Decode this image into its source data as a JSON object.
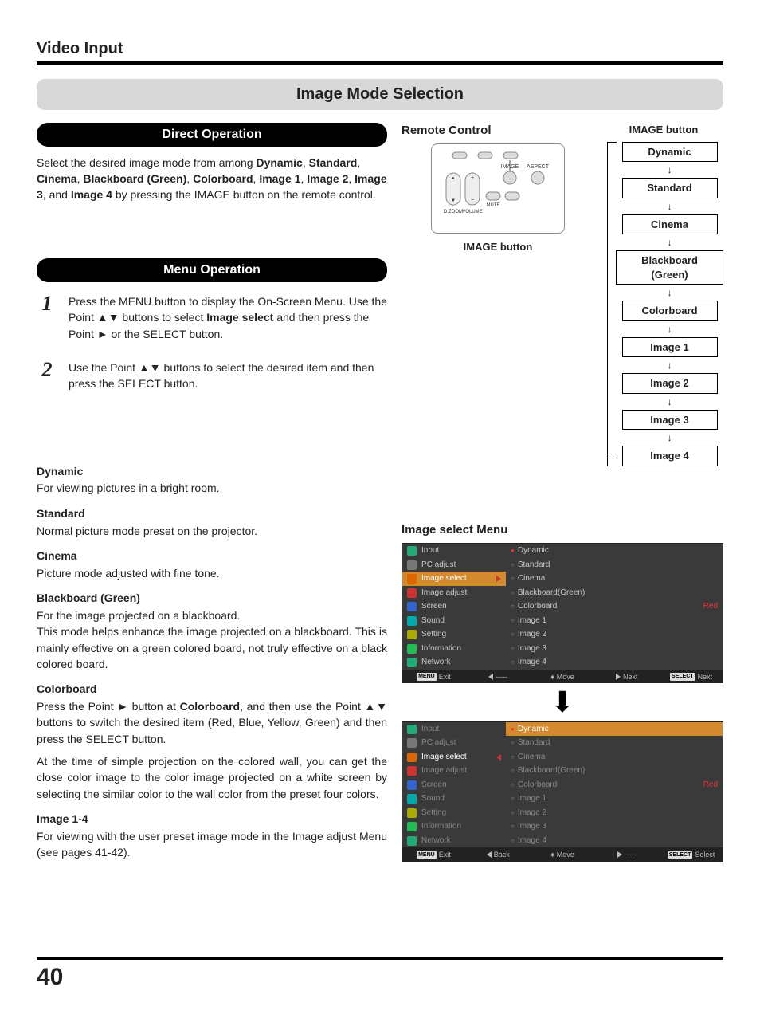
{
  "header": "Video Input",
  "title": "Image Mode Selection",
  "direct_op": {
    "heading": "Direct Operation",
    "text_pre": "Select the desired image mode from among ",
    "modes": "Dynamic, Standard, Cinema, Blackboard (Green), Colorboard, Image 1, Image 2, Image 3, and Image 4",
    "text_post": " by pressing the IMAGE button on the remote control."
  },
  "menu_op": {
    "heading": "Menu Operation",
    "steps": [
      {
        "num": "1",
        "text_pre": "Press the MENU button to display the On-Screen Menu. Use the Point ▲▼ buttons to select ",
        "bold": "Image select",
        "text_post": " and then press the Point ► or the SELECT button."
      },
      {
        "num": "2",
        "text_pre": "Use the Point ▲▼ buttons to select the desired item and then press the SELECT button.",
        "bold": "",
        "text_post": ""
      }
    ]
  },
  "modes_desc": [
    {
      "title": "Dynamic",
      "desc": "For viewing pictures in a bright room."
    },
    {
      "title": "Standard",
      "desc": "Normal picture mode preset on the projector."
    },
    {
      "title": "Cinema",
      "desc": "Picture mode adjusted with fine tone."
    },
    {
      "title": "Blackboard (Green)",
      "desc": "For the image projected on a blackboard.\nThis mode helps enhance the image projected on a blackboard. This is mainly effective on a green colored board, not truly effective on a black colored board."
    },
    {
      "title": "Colorboard",
      "desc_pre": "Press the Point ► button at ",
      "bold": "Colorboard",
      "desc_mid": ", and then use the Point ▲▼ buttons to switch the desired item (Red, Blue, Yellow, Green) and then press the SELECT button.",
      "desc2": "At the time of simple projection on the colored wall, you can get the close color image to the color image projected on a white screen by selecting the similar color to the wall color from the preset four colors."
    },
    {
      "title": "Image 1-4",
      "desc": "For viewing with the user preset image mode in the Image adjust Menu (see pages 41-42)."
    }
  ],
  "right": {
    "remote_heading": "Remote Control",
    "image_button_top": "IMAGE button",
    "image_button_below": "IMAGE button",
    "remote_labels": {
      "image": "IMAGE",
      "aspect": "ASPECT",
      "dzoom": "D.ZOOM",
      "volume": "VOLUME",
      "mute": "MUTE"
    },
    "flow": [
      "Dynamic",
      "Standard",
      "Cinema",
      "Blackboard (Green)",
      "Colorboard",
      "Image 1",
      "Image 2",
      "Image 3",
      "Image 4"
    ],
    "menu_heading": "Image select Menu",
    "osd_left_items": [
      "Input",
      "PC adjust",
      "Image select",
      "Image adjust",
      "Screen",
      "Sound",
      "Setting",
      "Information",
      "Network"
    ],
    "osd_right_items": [
      "Dynamic",
      "Standard",
      "Cinema",
      "Blackboard(Green)",
      "Colorboard",
      "Image 1",
      "Image 2",
      "Image 3",
      "Image 4"
    ],
    "osd_right_extra": "Red",
    "footer1": {
      "a": "Exit",
      "b": "-----",
      "c": "Move",
      "d": "Next",
      "e": "Next",
      "menu": "MENU",
      "select": "SELECT"
    },
    "footer2": {
      "a": "Exit",
      "b": "Back",
      "c": "Move",
      "d": "-----",
      "e": "Select",
      "menu": "MENU",
      "select": "SELECT"
    }
  },
  "page_number": "40"
}
